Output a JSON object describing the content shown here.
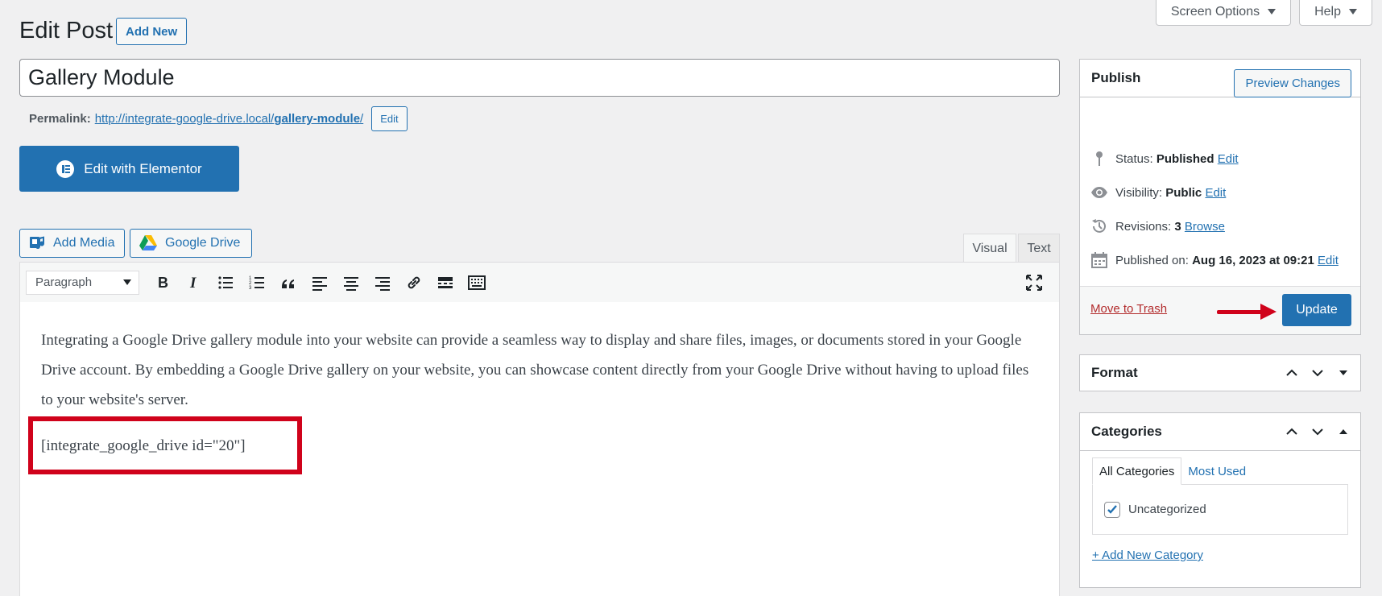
{
  "screen_options": {
    "screen_options_label": "Screen Options",
    "help_label": "Help"
  },
  "header": {
    "title": "Edit Post",
    "add_new_label": "Add New"
  },
  "post": {
    "title": "Gallery Module",
    "permalink_label": "Permalink:",
    "permalink_base": "http://integrate-google-drive.local/",
    "permalink_slug": "gallery-module",
    "permalink_trailing": "/",
    "permalink_edit_label": "Edit"
  },
  "elementor": {
    "label": "Edit with Elementor"
  },
  "media_buttons": {
    "add_media": "Add Media",
    "google_drive": "Google Drive"
  },
  "editor_tabs": {
    "visual": "Visual",
    "text": "Text"
  },
  "toolbar": {
    "format_select": "Paragraph"
  },
  "content": {
    "paragraph": "Integrating a Google Drive gallery module into your website can provide a seamless way to display and share files, images, or documents stored in your Google Drive account. By embedding a Google Drive gallery on your website, you can showcase content directly from your Google Drive without having to upload files to your website's server.",
    "shortcode": "[integrate_google_drive id=\"20\"]"
  },
  "publish": {
    "title": "Publish",
    "preview_label": "Preview Changes",
    "status_label": "Status:",
    "status_value": "Published",
    "visibility_label": "Visibility:",
    "visibility_value": "Public",
    "revisions_label": "Revisions:",
    "revisions_value": "3",
    "browse_label": "Browse",
    "published_on_label": "Published on:",
    "published_on_value": "Aug 16, 2023 at 09:21",
    "edit_label": "Edit",
    "trash_label": "Move to Trash",
    "update_label": "Update"
  },
  "format_box": {
    "title": "Format"
  },
  "categories": {
    "title": "Categories",
    "tab_all": "All Categories",
    "tab_most_used": "Most Used",
    "items": [
      {
        "label": "Uncategorized",
        "checked": true
      }
    ],
    "add_new_label": "+ Add New Category"
  },
  "colors": {
    "accent": "#2271b1",
    "highlight_red": "#d0021b",
    "trash_red": "#b32d2e"
  }
}
